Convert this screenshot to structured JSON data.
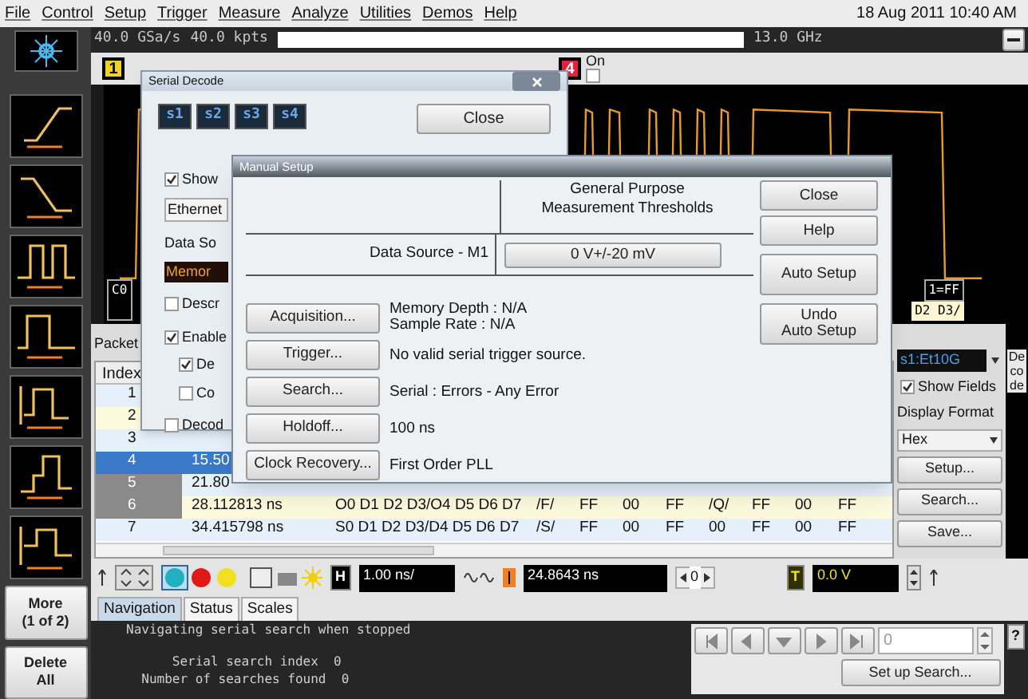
{
  "menu": [
    {
      "label": "File"
    },
    {
      "label": "Control"
    },
    {
      "label": "Setup"
    },
    {
      "label": "Trigger"
    },
    {
      "label": "Measure"
    },
    {
      "label": "Analyze"
    },
    {
      "label": "Utilities"
    },
    {
      "label": "Demos"
    },
    {
      "label": "Help"
    }
  ],
  "clock": "18 Aug 2011 10:40 AM",
  "sidebar_buttons": [
    {
      "label": "More\n(1 of 2)"
    },
    {
      "label": "Delete\nAll"
    }
  ],
  "acquisition": {
    "sample_rate": "40.0 GSa/s",
    "points": "40.0 kpts",
    "bandwidth": "13.0 GHz"
  },
  "channels": [
    {
      "label": "1",
      "color": "#f0d020"
    },
    {
      "label": "4",
      "color": "#e8203c",
      "status": "On",
      "checked": false
    }
  ],
  "decode_bus": {
    "left": "C0",
    "right_top": "1=FF",
    "right": "D2 D3/"
  },
  "packet_table": {
    "title": "Packet",
    "columns": [
      "Index"
    ],
    "rows": [
      {
        "index": "1",
        "selected": false,
        "marked": false
      },
      {
        "index": "2",
        "selected": false,
        "marked": false
      },
      {
        "index": "3",
        "selected": false,
        "marked": false
      },
      {
        "index": "4",
        "time": "15.50",
        "selected": true,
        "marked": false
      },
      {
        "index": "5",
        "time": "21.80",
        "selected": false,
        "marked": true
      },
      {
        "index": "6",
        "time": "28.112813 ns",
        "data": [
          "O0 D1 D2 D3/O4 D5 D6 D7",
          "/F/",
          "FF",
          "00",
          "FF",
          "/Q/",
          "FF",
          "00",
          "FF"
        ],
        "selected": false,
        "marked": true
      },
      {
        "index": "7",
        "time": "34.415798 ns",
        "data": [
          "S0 D1 D2 D3/D4 D5 D6 D7",
          "/S/",
          "FF",
          "00",
          "FF",
          "00",
          "FF",
          "00",
          "FF"
        ],
        "selected": false,
        "marked": false
      }
    ]
  },
  "decode_panel": {
    "bus": "s1:Et10G",
    "show_fields": {
      "label": "Show Fields",
      "checked": true
    },
    "format_label": "Display Format",
    "format": "Hex",
    "buttons": [
      "Setup...",
      "Search...",
      "Save..."
    ],
    "tab": "Decode"
  },
  "control_bar": {
    "h_label": "H",
    "timebase": "1.00 ns/",
    "delay": "24.8643 ns",
    "index": "0",
    "trigger_label": "T",
    "trigger_level": "0.0 V"
  },
  "bottom_tabs": [
    {
      "label": "Navigation",
      "selected": true
    },
    {
      "label": "Status",
      "selected": false
    },
    {
      "label": "Scales",
      "selected": false
    }
  ],
  "console": [
    "Navigating serial search when stopped",
    "      Serial search index  0",
    "  Number of searches found  0"
  ],
  "navigation": {
    "placeholder": "0",
    "help": "?",
    "setup_button": "Set up Search..."
  },
  "serial_decode": {
    "title": "Serial Decode",
    "slots": [
      {
        "label": "s1",
        "selected": false
      },
      {
        "label": "s2",
        "selected": false
      },
      {
        "label": "s3",
        "selected": false
      },
      {
        "label": "s4",
        "selected": false
      }
    ],
    "close": "Close",
    "show": {
      "label": "Show",
      "checked": true
    },
    "protocol": "Ethernet",
    "data_source_label": "Data So",
    "data_source": "Memor",
    "options": [
      {
        "label": "Descr",
        "checked": false
      },
      {
        "label": "Enable",
        "checked": true,
        "children": [
          {
            "label": "De",
            "checked": true
          },
          {
            "label": "Co",
            "checked": false
          }
        ]
      },
      {
        "label": "Decod",
        "checked": false
      }
    ]
  },
  "manual_setup": {
    "title": "Manual Setup",
    "threshold_header": "General Purpose\nMeasurement Thresholds",
    "data_source": "Data Source - M1",
    "threshold": "0 V+/-20 mV",
    "buttons": [
      "Close",
      "Help",
      "Auto Setup",
      "Undo\nAuto Setup"
    ],
    "rows": [
      {
        "button": "Acquisition...",
        "value": "Memory Depth : N/A\nSample Rate : N/A"
      },
      {
        "button": "Trigger...",
        "value": "No valid serial trigger source."
      },
      {
        "button": "Search...",
        "value": "Serial : Errors - Any Error"
      },
      {
        "button": "Holdoff...",
        "value": "100 ns"
      },
      {
        "button": "Clock Recovery...",
        "value": "First Order PLL"
      }
    ]
  }
}
